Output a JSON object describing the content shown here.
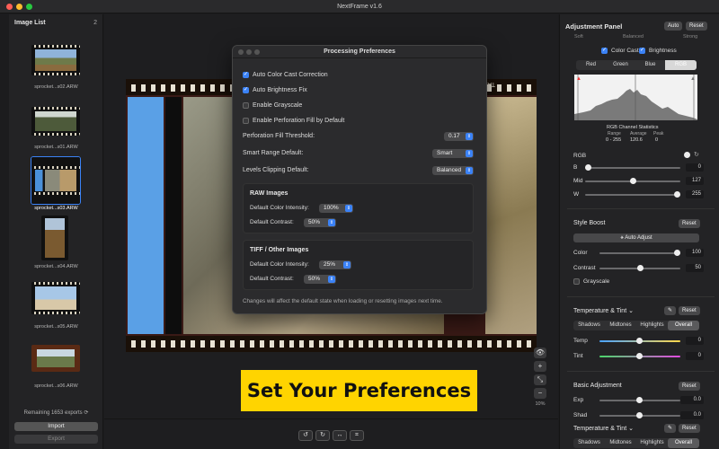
{
  "window": {
    "title": "NextFrame v1.6"
  },
  "sidebar": {
    "title": "Image List",
    "count": "2",
    "files": [
      "sprocket...s02.ARW",
      "sprocket...s01.ARW",
      "sprocket...s03.ARW",
      "sprocket...s04.ARW",
      "sprocket...s05.ARW",
      "sprocket...s06.ARW"
    ],
    "remaining": "Remaining 1653 exports",
    "import_label": "Import",
    "export_label": "Export"
  },
  "main": {
    "banner": "Set Your Preferences",
    "zoom_level": "10%",
    "film_edge_text": "TAN  5213"
  },
  "dialog": {
    "title": "Processing Preferences",
    "checks": [
      {
        "label": "Auto Color Cast Correction",
        "checked": true
      },
      {
        "label": "Auto Brightness Fix",
        "checked": true
      },
      {
        "label": "Enable Grayscale",
        "checked": false
      },
      {
        "label": "Enable Perforation Fill by Default",
        "checked": false
      }
    ],
    "threshold_label": "Perforation Fill Threshold:",
    "threshold_value": "0.17",
    "smart_label": "Smart Range Default:",
    "smart_value": "Smart",
    "levels_label": "Levels Clipping Default:",
    "levels_value": "Balanced",
    "raw": {
      "title": "RAW Images",
      "intensity_label": "Default Color Intensity:",
      "intensity_value": "100%",
      "contrast_label": "Default Contrast:",
      "contrast_value": "50%"
    },
    "tiff": {
      "title": "TIFF / Other Images",
      "intensity_label": "Default Color Intensity:",
      "intensity_value": "25%",
      "contrast_label": "Default Contrast:",
      "contrast_value": "50%"
    },
    "footer": "Changes will affect the default state when loading or resetting images next time."
  },
  "panel": {
    "title": "Adjustment Panel",
    "auto_label": "Auto",
    "reset_label": "Reset",
    "top_labels": [
      "Soft",
      "Balanced",
      "Strong"
    ],
    "color_cast_label": "Color Cast",
    "brightness_label": "Brightness",
    "channels": [
      "Red",
      "Green",
      "Blue",
      "RGB"
    ],
    "stats_title": "RGB Channel Statistics",
    "stats_headers": [
      "Range",
      "Average",
      "Peak"
    ],
    "stats_values": [
      "0 - 255",
      "120.6",
      "0"
    ],
    "rgb_label": "RGB",
    "levels": [
      {
        "label": "B",
        "value": "0",
        "pos": 0
      },
      {
        "label": "Mid",
        "value": "127",
        "pos": 0.5
      },
      {
        "label": "W",
        "value": "255",
        "pos": 1
      }
    ],
    "style_boost": {
      "title": "Style Boost",
      "reset": "Reset",
      "auto_adjust": "Auto Adjust",
      "color_label": "Color",
      "color_value": "100",
      "color_pos": 1,
      "contrast_label": "Contrast",
      "contrast_value": "50",
      "contrast_pos": 0.5,
      "grayscale_label": "Grayscale"
    },
    "temp_tint": {
      "title": "Temperature & Tint",
      "reset": "Reset",
      "tabs": [
        "Shadows",
        "Midtones",
        "Highlights",
        "Overall"
      ],
      "temp_label": "Temp",
      "temp_value": "0",
      "tint_label": "Tint",
      "tint_value": "0"
    },
    "basic": {
      "title": "Basic Adjustment",
      "reset": "Reset",
      "exp_label": "Exp",
      "exp_value": "0.0",
      "shad_label": "Shad",
      "shad_value": "0.0"
    },
    "temp_tint2": {
      "title": "Temperature & Tint",
      "reset": "Reset",
      "tabs": [
        "Shadows",
        "Midtones",
        "Highlights",
        "Overall"
      ]
    }
  },
  "colors": {
    "accent": "#3b82f6",
    "banner": "#ffd400"
  }
}
